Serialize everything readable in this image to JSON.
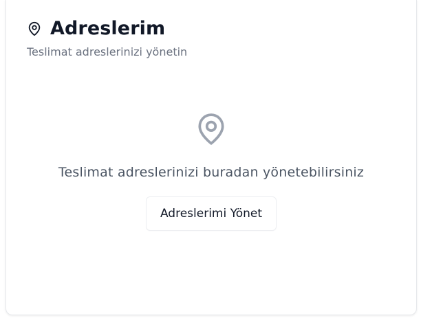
{
  "header": {
    "title": "Adreslerim",
    "subtitle": "Teslimat adreslerinizi yönetin",
    "icon": "map-pin-icon"
  },
  "empty_state": {
    "icon": "map-pin-icon",
    "message": "Teslimat adreslerinizi buradan yönetebilirsiniz",
    "button_label": "Adreslerimi Yönet"
  },
  "colors": {
    "title": "#111827",
    "subtitle": "#6b7280",
    "icon_muted": "#9ca3af",
    "border": "#e6e8eb"
  }
}
